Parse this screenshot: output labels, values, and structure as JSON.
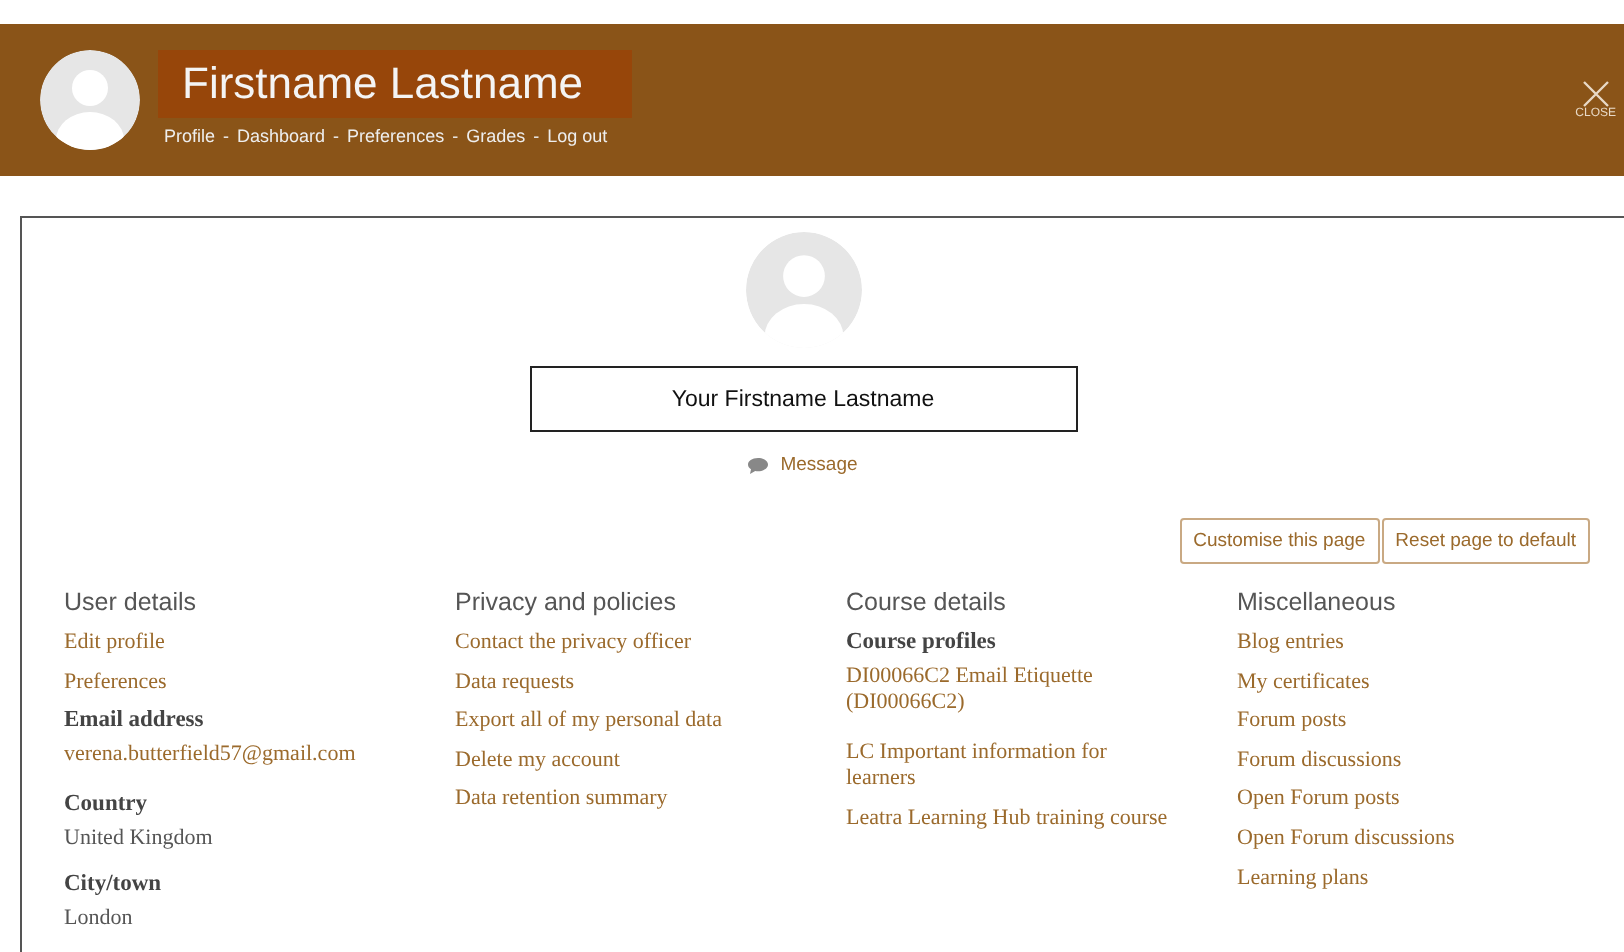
{
  "header": {
    "name": "Firstname Lastname",
    "nav": [
      "Profile",
      "Dashboard",
      "Preferences",
      "Grades",
      "Log out"
    ],
    "separator": "-",
    "close": "CLOSE"
  },
  "profile": {
    "name": "Your Firstname Lastname",
    "message": "Message",
    "buttons": [
      "Customise this page",
      "Reset page to default"
    ]
  },
  "columns": [
    {
      "title": "User details",
      "items": [
        {
          "kind": "link",
          "text": "Edit profile"
        },
        {
          "kind": "link",
          "text": "Preferences"
        },
        {
          "kind": "label",
          "text": "Email address"
        },
        {
          "kind": "link",
          "text": "verena.butterfield57@gmail.com"
        },
        {
          "kind": "label",
          "text": "Country"
        },
        {
          "kind": "value",
          "text": "United Kingdom"
        },
        {
          "kind": "label",
          "text": "City/town"
        },
        {
          "kind": "value",
          "text": "London"
        }
      ]
    },
    {
      "title": "Privacy and policies",
      "items": [
        {
          "kind": "link",
          "text": "Contact the privacy officer"
        },
        {
          "kind": "link",
          "text": "Data requests"
        },
        {
          "kind": "link",
          "text": "Export all of my personal data"
        },
        {
          "kind": "link",
          "text": "Delete my account"
        },
        {
          "kind": "link",
          "text": "Data retention summary"
        }
      ]
    },
    {
      "title": "Course details",
      "items": [
        {
          "kind": "label",
          "text": "Course profiles"
        },
        {
          "kind": "link",
          "text": "DI00066C2 Email Etiquette (DI00066C2)"
        },
        {
          "kind": "link",
          "text": "LC Important information for learners"
        },
        {
          "kind": "link",
          "text": "Leatra Learning Hub training course"
        }
      ]
    },
    {
      "title": "Miscellaneous",
      "items": [
        {
          "kind": "link",
          "text": "Blog entries"
        },
        {
          "kind": "link",
          "text": "My certificates"
        },
        {
          "kind": "link",
          "text": "Forum posts"
        },
        {
          "kind": "link",
          "text": "Forum discussions"
        },
        {
          "kind": "link",
          "text": "Open Forum posts"
        },
        {
          "kind": "link",
          "text": "Open Forum discussions"
        },
        {
          "kind": "link",
          "text": "Learning plans"
        }
      ]
    }
  ]
}
